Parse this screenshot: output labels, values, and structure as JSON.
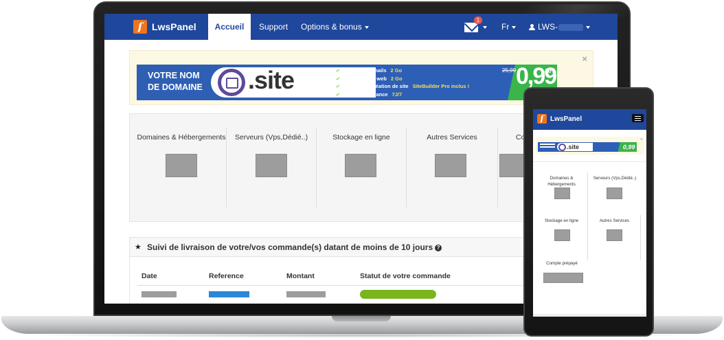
{
  "navbar": {
    "brand": "LwsPanel",
    "brand_logo_glyph": "ſ",
    "items": [
      {
        "label": "Accueil",
        "active": true
      },
      {
        "label": "Support"
      },
      {
        "label": "Options & bonus"
      }
    ],
    "mail_badge": "1",
    "language": "Fr",
    "user_label": "LWS-"
  },
  "banner": {
    "line1": "VOTRE NOM",
    "line2": "DE DOMAINE",
    "domain": ".site",
    "features": [
      {
        "text": "2 adresses emails",
        "highlight": "2 Go"
      },
      {
        "text": "Hébergement web",
        "highlight": "2 Go"
      },
      {
        "text": "Logiciel de création de site",
        "highlight": "SiteBuilder Pro inclus !"
      },
      {
        "text": "Support en France",
        "highlight": "7J/7"
      }
    ],
    "old_price": "25,99",
    "price": "0,99",
    "discount": "-90%",
    "close": "×"
  },
  "services": [
    {
      "title": "Domaines & Hébergements"
    },
    {
      "title": "Serveurs (Vps,Dédié..)"
    },
    {
      "title": "Stockage en ligne"
    },
    {
      "title": "Autres Services"
    },
    {
      "title": "Co"
    }
  ],
  "orders": {
    "title": "Suivi de livraison de votre/vos commande(s) datant de moins de 10 jours",
    "help": "?",
    "columns": [
      "Date",
      "Reference",
      "Montant",
      "Statut de votre commande"
    ],
    "status_color": "#7ab51d",
    "reference_color": "#2a86d8"
  },
  "phone": {
    "brand": "LwsPanel",
    "banner_domain": ".site",
    "banner_price": "0,99",
    "close": "×",
    "services": [
      {
        "title": "Domaines & Hébergements"
      },
      {
        "title": "Serveurs (Vps,Dédié..)"
      },
      {
        "title": "Stockage en ligne"
      },
      {
        "title": "Autres Services"
      },
      {
        "title": "Compte prépayé"
      }
    ]
  },
  "colors": {
    "navbar": "#1f479b",
    "logo": "#f0741e",
    "banner_blue": "#2d5fb8",
    "banner_green": "#39b54a",
    "placeholder_grey": "#9d9d9d"
  }
}
